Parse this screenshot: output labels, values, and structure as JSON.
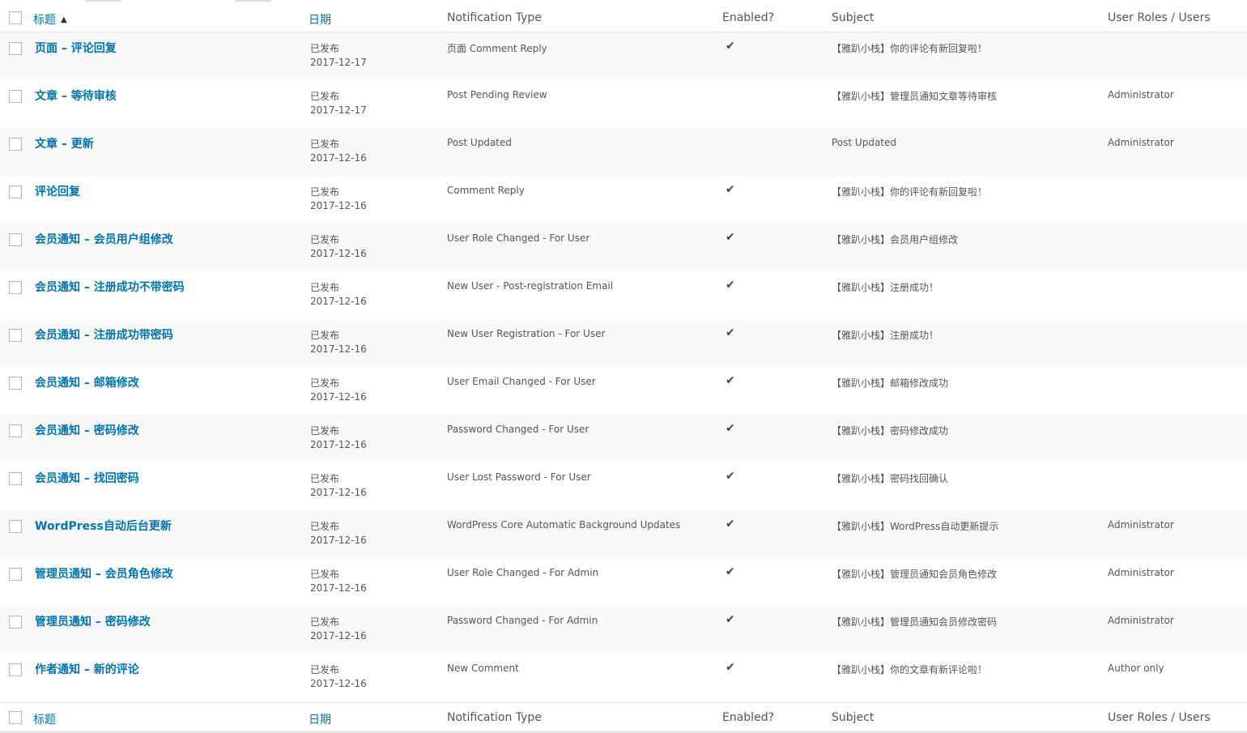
{
  "columns": {
    "title": "标题",
    "date": "日期",
    "type": "Notification Type",
    "enabled": "Enabled?",
    "subject": "Subject",
    "roles": "User Roles / Users"
  },
  "sort_icon": "sort-ascending-icon",
  "enabled_icon": "checkmark-icon",
  "check_glyph": "✔",
  "rows": [
    {
      "title": "页面 – 评论回复",
      "status": "已发布",
      "date": "2017-12-17",
      "type": "页面 Comment Reply",
      "enabled": true,
      "subject": "【雅趴小栈】你的评论有新回复啦！",
      "roles": ""
    },
    {
      "title": "文章 – 等待审核",
      "status": "已发布",
      "date": "2017-12-17",
      "type": "Post Pending Review",
      "enabled": false,
      "subject": "【雅趴小栈】管理员通知文章等待审核",
      "roles": "Administrator"
    },
    {
      "title": "文章 – 更新",
      "status": "已发布",
      "date": "2017-12-16",
      "type": "Post Updated",
      "enabled": false,
      "subject": "Post Updated",
      "roles": "Administrator"
    },
    {
      "title": "评论回复",
      "status": "已发布",
      "date": "2017-12-16",
      "type": "Comment Reply",
      "enabled": true,
      "subject": "【雅趴小栈】你的评论有新回复啦！",
      "roles": ""
    },
    {
      "title": "会员通知 – 会员用户组修改",
      "status": "已发布",
      "date": "2017-12-16",
      "type": "User Role Changed - For User",
      "enabled": true,
      "subject": "【雅趴小栈】会员用户组修改",
      "roles": ""
    },
    {
      "title": "会员通知 – 注册成功不带密码",
      "status": "已发布",
      "date": "2017-12-16",
      "type": "New User - Post-registration Email",
      "enabled": true,
      "subject": "【雅趴小栈】注册成功！",
      "roles": ""
    },
    {
      "title": "会员通知 – 注册成功带密码",
      "status": "已发布",
      "date": "2017-12-16",
      "type": "New User Registration - For User",
      "enabled": true,
      "subject": "【雅趴小栈】注册成功！",
      "roles": ""
    },
    {
      "title": "会员通知 – 邮箱修改",
      "status": "已发布",
      "date": "2017-12-16",
      "type": "User Email Changed - For User",
      "enabled": true,
      "subject": "【雅趴小栈】邮箱修改成功",
      "roles": ""
    },
    {
      "title": "会员通知 – 密码修改",
      "status": "已发布",
      "date": "2017-12-16",
      "type": "Password Changed - For User",
      "enabled": true,
      "subject": "【雅趴小栈】密码修改成功",
      "roles": ""
    },
    {
      "title": "会员通知 – 找回密码",
      "status": "已发布",
      "date": "2017-12-16",
      "type": "User Lost Password - For User",
      "enabled": true,
      "subject": "【雅趴小栈】密码找回确认",
      "roles": ""
    },
    {
      "title": "WordPress自动后台更新",
      "status": "已发布",
      "date": "2017-12-16",
      "type": "WordPress Core Automatic Background Updates",
      "enabled": true,
      "subject": "【雅趴小栈】WordPress自动更新提示",
      "roles": "Administrator"
    },
    {
      "title": "管理员通知 – 会员角色修改",
      "status": "已发布",
      "date": "2017-12-16",
      "type": "User Role Changed - For Admin",
      "enabled": true,
      "subject": "【雅趴小栈】管理员通知会员角色修改",
      "roles": "Administrator"
    },
    {
      "title": "管理员通知 – 密码修改",
      "status": "已发布",
      "date": "2017-12-16",
      "type": "Password Changed - For Admin",
      "enabled": true,
      "subject": "【雅趴小栈】管理员通知会员修改密码",
      "roles": "Administrator"
    },
    {
      "title": "作者通知 – 新的评论",
      "status": "已发布",
      "date": "2017-12-16",
      "type": "New Comment",
      "enabled": true,
      "subject": "【雅趴小栈】你的文章有新评论啦！",
      "roles": "Author only"
    }
  ],
  "colors": {
    "link": "#0073aa",
    "text": "#555555",
    "row_alt": "#f9f9f9",
    "border": "#e1e1e1"
  }
}
